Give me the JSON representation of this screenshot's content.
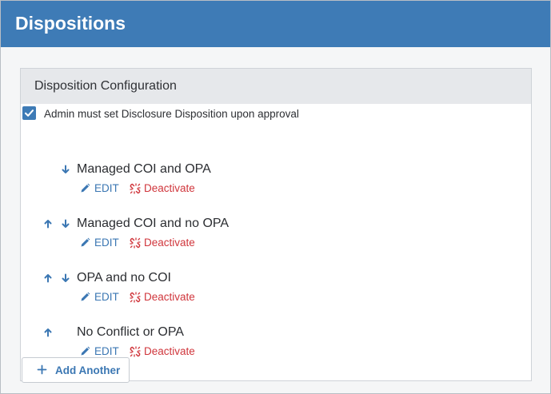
{
  "header": {
    "title": "Dispositions"
  },
  "config": {
    "title": "Disposition Configuration",
    "checkbox": {
      "checked": true,
      "label": "Admin must set Disclosure Disposition upon approval"
    },
    "items": [
      {
        "name": "Managed COI and OPA",
        "can_move_up": false,
        "can_move_down": true,
        "edit_label": "EDIT",
        "deactivate_label": "Deactivate"
      },
      {
        "name": "Managed COI and no OPA",
        "can_move_up": true,
        "can_move_down": true,
        "edit_label": "EDIT",
        "deactivate_label": "Deactivate"
      },
      {
        "name": "OPA and no COI",
        "can_move_up": true,
        "can_move_down": true,
        "edit_label": "EDIT",
        "deactivate_label": "Deactivate"
      },
      {
        "name": "No Conflict or OPA",
        "can_move_up": true,
        "can_move_down": false,
        "edit_label": "EDIT",
        "deactivate_label": "Deactivate"
      }
    ],
    "add_button": {
      "label": "Add Another",
      "icon": "plus-icon"
    }
  },
  "colors": {
    "header_bg": "#3e7bb6",
    "link_blue": "#3b77b3",
    "deactivate_red": "#d0363c",
    "card_head_bg": "#e6e8eb"
  },
  "icons": {
    "up": "arrow-up-icon",
    "down": "arrow-down-icon",
    "edit": "pencil-icon",
    "deactivate": "unlink-icon",
    "check": "check-icon"
  }
}
